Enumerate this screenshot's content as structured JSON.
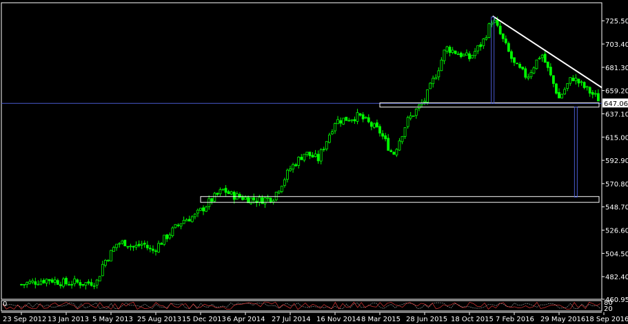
{
  "chart_data": {
    "type": "candlestick",
    "title": "",
    "xlabel": "",
    "ylabel": "",
    "ylim": [
      460.95,
      740.0
    ],
    "grid": false,
    "bull_color": "#00ff00",
    "down_color": "#00ff00",
    "background": "#000000",
    "axis_color": "#ffffff",
    "current_price": 647.06,
    "current_price_label": "647.06",
    "y_ticks": [
      "725.50",
      "703.40",
      "681.30",
      "659.20",
      "637.10",
      "615.00",
      "592.90",
      "570.80",
      "548.70",
      "526.60",
      "504.50",
      "482.40",
      "460.95"
    ],
    "x_ticks": [
      "23 Sep 2012",
      "13 Jan 2013",
      "5 May 2013",
      "25 Aug 2013",
      "15 Dec 2013",
      "6 Apr 2014",
      "27 Jul 2014",
      "16 Nov 2014",
      "8 Mar 2015",
      "28 Jun 2015",
      "18 Oct 2015",
      "7 Feb 2016",
      "29 May 2016",
      "18 Sep 2016"
    ],
    "path_points": [
      {
        "x": "23 Sep 2012",
        "y": 475
      },
      {
        "x": "1 Nov 2012",
        "y": 478
      },
      {
        "x": "30 Nov 2012",
        "y": 480
      },
      {
        "x": "13 Jan 2013",
        "y": 476
      },
      {
        "x": "1 Feb 2013",
        "y": 477
      },
      {
        "x": "1 Mar 2013",
        "y": 476
      },
      {
        "x": "1 Apr 2013",
        "y": 478
      },
      {
        "x": "15 Apr 2013",
        "y": 495
      },
      {
        "x": "5 May 2013",
        "y": 505
      },
      {
        "x": "20 May 2013",
        "y": 514
      },
      {
        "x": "10 Jun 2013",
        "y": 515
      },
      {
        "x": "1 Jul 2013",
        "y": 510
      },
      {
        "x": "25 Jul 2013",
        "y": 514
      },
      {
        "x": "15 Aug 2013",
        "y": 506
      },
      {
        "x": "25 Aug 2013",
        "y": 510
      },
      {
        "x": "25 Sep 2013",
        "y": 522
      },
      {
        "x": "1 Nov 2013",
        "y": 536
      },
      {
        "x": "1 Dec 2013",
        "y": 540
      },
      {
        "x": "15 Dec 2013",
        "y": 545
      },
      {
        "x": "10 Jan 2014",
        "y": 555
      },
      {
        "x": "10 Feb 2014",
        "y": 565
      },
      {
        "x": "1 Mar 2014",
        "y": 560
      },
      {
        "x": "6 Apr 2014",
        "y": 557
      },
      {
        "x": "10 May 2014",
        "y": 555
      },
      {
        "x": "15 Jun 2014",
        "y": 558
      },
      {
        "x": "27 Jul 2014",
        "y": 585
      },
      {
        "x": "1 Sep 2014",
        "y": 600
      },
      {
        "x": "5 Oct 2014",
        "y": 594
      },
      {
        "x": "16 Nov 2014",
        "y": 630
      },
      {
        "x": "15 Jan 2015",
        "y": 635
      },
      {
        "x": "8 Mar 2015",
        "y": 620
      },
      {
        "x": "10 Apr 2015",
        "y": 598
      },
      {
        "x": "15 May 2015",
        "y": 630
      },
      {
        "x": "28 Jun 2015",
        "y": 650
      },
      {
        "x": "1 Aug 2015",
        "y": 680
      },
      {
        "x": "20 Aug 2015",
        "y": 700
      },
      {
        "x": "18 Oct 2015",
        "y": 690
      },
      {
        "x": "20 Nov 2015",
        "y": 705
      },
      {
        "x": "15 Dec 2015",
        "y": 728
      },
      {
        "x": "7 Feb 2016",
        "y": 684
      },
      {
        "x": "10 Mar 2016",
        "y": 672
      },
      {
        "x": "15 Apr 2016",
        "y": 695
      },
      {
        "x": "29 May 2016",
        "y": 652
      },
      {
        "x": "1 Jul 2016",
        "y": 672
      },
      {
        "x": "1 Aug 2016",
        "y": 662
      },
      {
        "x": "18 Sep 2016",
        "y": 647
      }
    ],
    "annotations": [
      {
        "type": "trendline",
        "from": {
          "x": "15 Dec 2015",
          "y": 730
        },
        "to": {
          "x": "1 Oct 2016",
          "y": 662
        },
        "color": "#ffffff"
      },
      {
        "type": "hline",
        "y": 647.06,
        "color": "#4a5bd0"
      },
      {
        "type": "zone",
        "y_top": 647.5,
        "y_bottom": 643.5,
        "x_from": "8 Mar 2015",
        "x_to": "18 Sep 2016",
        "color": "#ffffff"
      },
      {
        "type": "zone",
        "y_top": 558.5,
        "y_bottom": 553.0,
        "x_from": "15 Dec 2013",
        "x_to": "1 Oct 2016",
        "color": "#ffffff"
      },
      {
        "type": "vrange",
        "x": "15 Dec 2015",
        "y_from": 729,
        "y_to": 647,
        "color": "#4a5bd0"
      },
      {
        "type": "vrange",
        "x": "10 Jul 2016",
        "y_from": 643.5,
        "y_to": 558,
        "color": "#4a5bd0"
      }
    ]
  },
  "indicator": {
    "label": "0",
    "levels": [
      "80",
      "20"
    ],
    "color_main": "#ff4040",
    "color_signal": "#b0b0b0"
  }
}
